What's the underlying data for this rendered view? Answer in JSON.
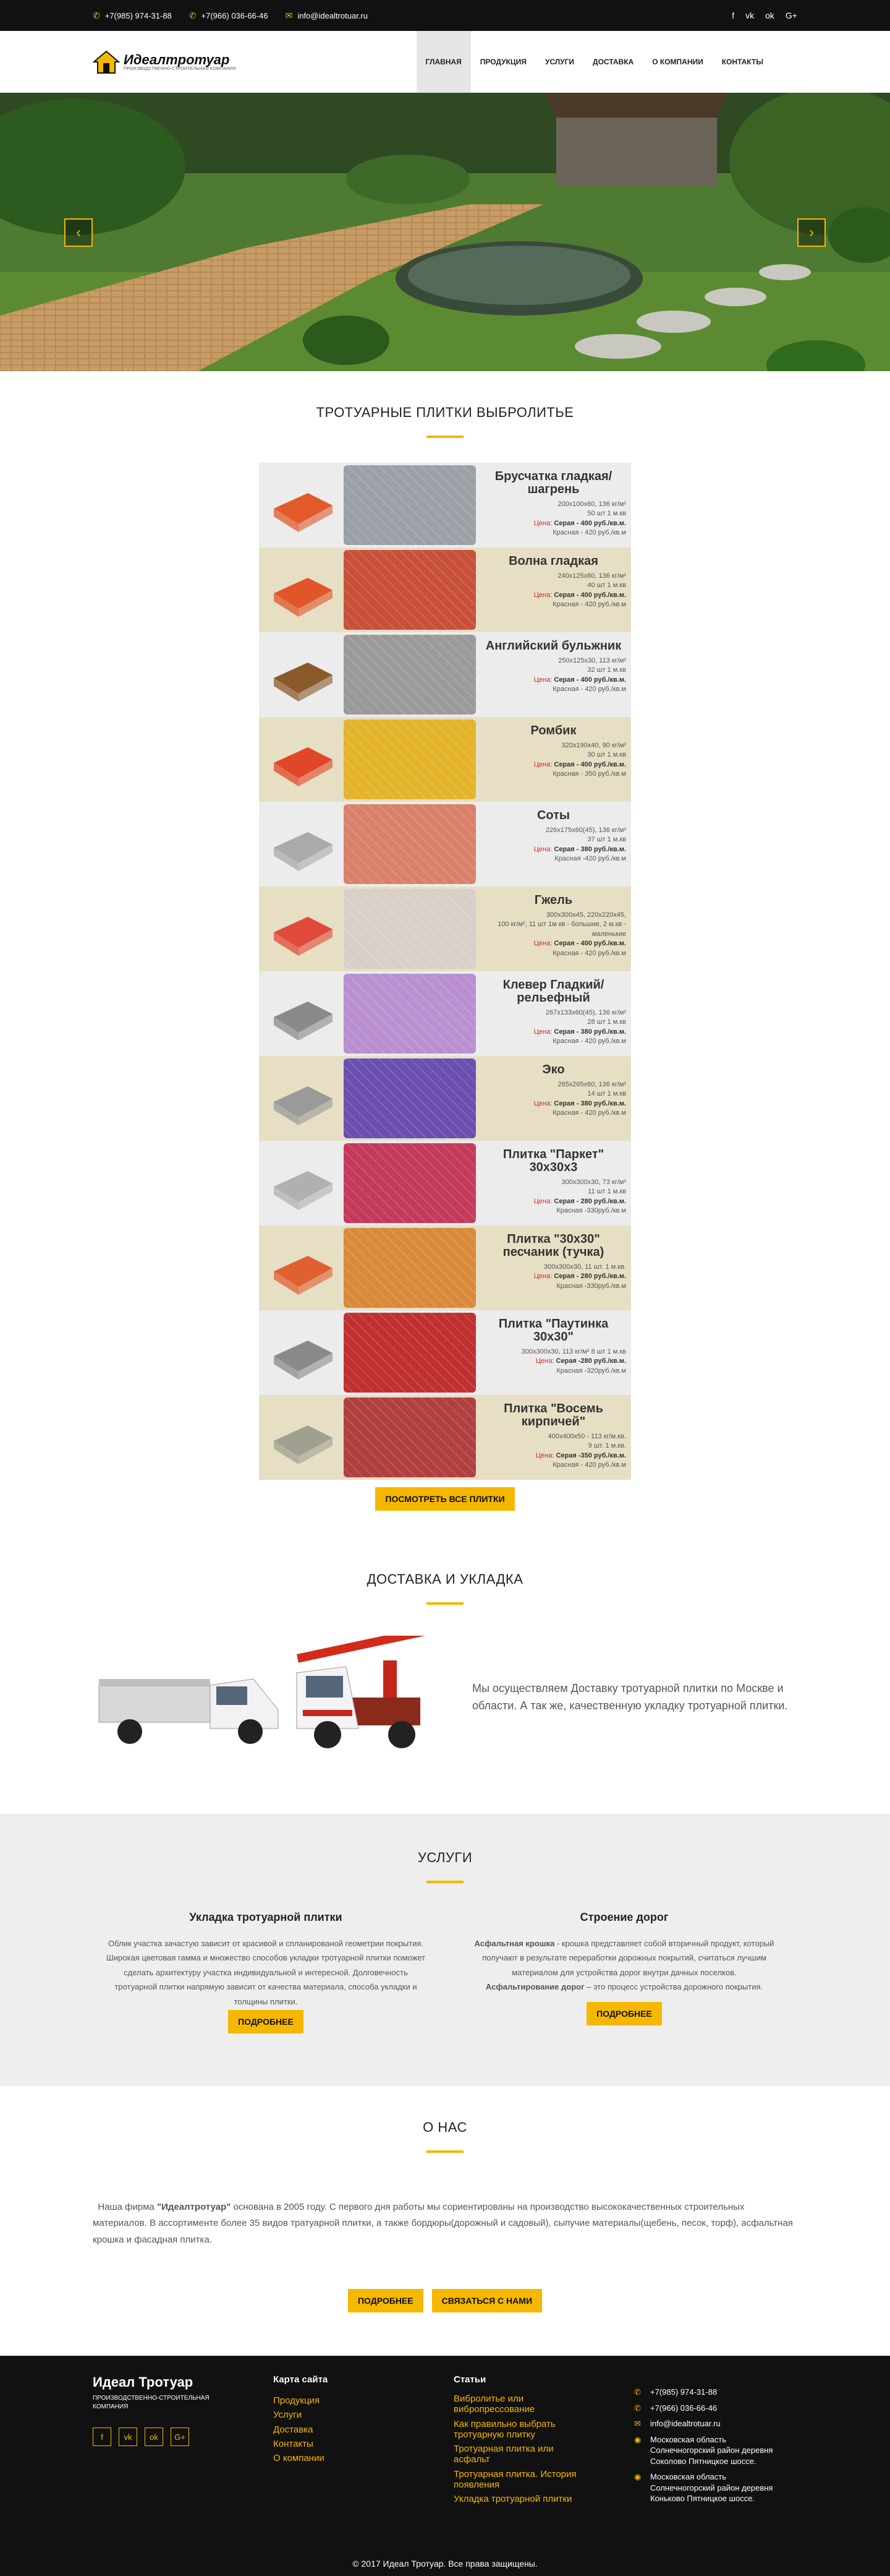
{
  "topbar": {
    "phone1": "+7(985) 974-31-88",
    "phone2": "+7(966) 036-66-46",
    "email": "info@idealtrotuar.ru",
    "social": [
      "f",
      "vk",
      "ok",
      "G+"
    ]
  },
  "header": {
    "logo_name": "Идеалтротуар",
    "logo_sub": "ПРОИЗВОДСТВЕННО-СТРОИТЕЛЬНАЯ КОМПАНИЯ",
    "nav": [
      "Главная",
      "Продукция",
      "Услуги",
      "Доставка",
      "О компании",
      "Контакты"
    ]
  },
  "hero": {
    "prev": "‹",
    "next": "›"
  },
  "catalog": {
    "title": "Тротуарные плитки выбролитье",
    "button": "ПОСМОТРЕТЬ ВСЕ ПЛИТКИ",
    "items": [
      {
        "title": "Брусчатка гладкая/ шагрень",
        "spec1": "200х100х60, 136 кг/м²",
        "spec2": "50 шт 1 м.кв",
        "price": "Серая - 400 руб./кв.м.",
        "red": "Красная - 420 руб./кв.м",
        "price_label": "Цена:"
      },
      {
        "title": "Волна гладкая",
        "spec1": "240х125х60, 136 кг/м²",
        "spec2": "40 шт 1 м.кв",
        "price": "Серая - 400 руб./кв.м.",
        "red": "Красная - 420 руб./кв.м",
        "price_label": "Цена:"
      },
      {
        "title": "Английский бульжник",
        "spec1": "250х125х30, 113 кг/м²",
        "spec2": "32 шт 1 м.кв",
        "price": "Серая - 400 руб./кв.м.",
        "red": "Красная - 420 руб./кв.м",
        "price_label": "Цена:"
      },
      {
        "title": "Ромбик",
        "spec1": "320х190х40, 90 кг/м²",
        "spec2": "30 шт 1 м.кв",
        "price": "Серая - 400 руб./кв.м.",
        "red": "Красная - 350 руб./кв.м",
        "price_label": "Цена:"
      },
      {
        "title": "Соты",
        "spec1": "226х175х60(45), 136 кг/м²",
        "spec2": "37 шт 1 м.кв",
        "price": "Серая - 380 руб./кв.м.",
        "red": "Красная -420 руб./кв.м",
        "price_label": "Цена:"
      },
      {
        "title": "Гжель",
        "spec1": "300х300х45, 220х220х45,",
        "spec2": "100 кг/м², 11 шт 1м кв - большие, 2 м.кв - маленькие",
        "price": "Серая - 400 руб./кв.м.",
        "red": "Красная - 420 руб./кв.м",
        "price_label": "Цена:"
      },
      {
        "title": "Клевер Гладкий/ рельефный",
        "spec1": "267х133х60(45), 136 кг/м²",
        "spec2": "28 шт 1 м.кв",
        "price": "Серая - 380 руб./кв.м.",
        "red": "Красная - 420 руб./кв.м",
        "price_label": "Цена:"
      },
      {
        "title": "Эко",
        "spec1": "265х265х60, 136 кг/м²",
        "spec2": "14 шт 1 м.кв",
        "price": "Серая - 380 руб./кв.м.",
        "red": "Красная - 420 руб./кв.м",
        "price_label": "Цена:"
      },
      {
        "title": "Плитка \"Паркет\" 30х30х3",
        "spec1": "300х300х30, 73 кг/м²",
        "spec2": "11 шт 1 м.кв",
        "price": "Серая - 280 руб./кв.м.",
        "red": "Красная -330руб./кв.м",
        "price_label": "Цена:"
      },
      {
        "title": "Плитка \"30х30\" песчаник (тучка)",
        "spec1": "300х300х30, 11 шт. 1 м.кв.",
        "spec2": "",
        "price": "Серая - 280 руб./кв.м.",
        "red": "Красная -330руб./кв.м",
        "price_label": "Цена:"
      },
      {
        "title": "Плитка \"Паутинка 30х30\"",
        "spec1": "300х300х30, 113 кг/м² 8 шт 1 м.кв",
        "spec2": "",
        "price": "Серая -280 руб./кв.м.",
        "red": "Красная -320руб./кв.м",
        "price_label": "Цена:"
      },
      {
        "title": "Плитка \"Восемь кирпичей\"",
        "spec1": "400х400х50 - 113 кг/м.кв.",
        "spec2": "9 шт. 1 м.кв.",
        "price": "Серая -350 руб./кв.м.",
        "red": "Красная - 420 руб./кв.м",
        "price_label": "Цена:"
      }
    ]
  },
  "delivery": {
    "title": "Доставка и укладка",
    "text": "Мы осуществляем Доставку тротуарной плитки по Москве и области. А так же, качественную укладку тротуарной плитки."
  },
  "services": {
    "title": "Услуги",
    "left_title": "Укладка тротуарной плитки",
    "left_text": "Облик участка зачастую зависит от красивой и спланированой геометрии покрытия. Широкая цветовая гамма и множество способов укладки тротуарной плитки поможет сделать архитектуру участка индивидуальной и интересной. Долговечность тротуарной плитки напрямую зависит от качества материала, способа укладки и толщины плитки.",
    "right_title": "Строение дорог",
    "right_b1": "Асфальтная крошка",
    "right_t1": " - крошка представляет собой вторичный продукт, который получают в результате переработки дорожных покрытий, считаться лучшим материалом для устройства дорог внутри дачных поселков.",
    "right_b2": "Асфальтирование дорог",
    "right_t2": " – это процесс устройства дорожного покрытия.",
    "more": "ПОДРОБНЕЕ"
  },
  "about": {
    "title": "О нас",
    "p1": "Наша фирма ",
    "brand": "\"Идеалтротуар\"",
    "p2": " основана в 2005 году. С первого дня работы мы сориентированы на производство высококачественных строительных материалов. В ассортименте более 35 видов тратуарной плитки, а также бордюры(дорожный и садовый), сыпучие материалы(щебень, песок, торф), асфальтная крошка и фасадная плитка.",
    "more": "ПОДРОБНЕЕ",
    "contact": "СВЯЗАТЬСЯ С НАМИ"
  },
  "footer": {
    "brand": "Идеал Тротуар",
    "brand_sub": "ПРОИЗВОДСТВЕННО-СТРОИТЕЛЬНАЯ КОМПАНИЯ",
    "map_title": "Карта сайта",
    "map_links": [
      "Продукция",
      "Услуги",
      "Доставка",
      "Контакты",
      "О компании"
    ],
    "articles_title": "Статьи",
    "articles": [
      "Вибролитье или вибропрессование",
      "Как правильно выбрать тротуарную плитку",
      "Тротуарная плитка или асфальт",
      "Тротуарная плитка. История появления",
      "Укладка тротуарной плитки"
    ],
    "phone1": "+7(985) 974-31-88",
    "phone2": "+7(966) 036-66-46",
    "email": "info@idealtrotuar.ru",
    "addr1": "Московская область Солнечногорский район деревня Соколово Пятницкое шоссе.",
    "addr2": "Московская область Солнечногорский район деревня Коньково Пятницкое шоссе.",
    "copyright": "© 2017 Идеал Тротуар. Все права защищены."
  }
}
